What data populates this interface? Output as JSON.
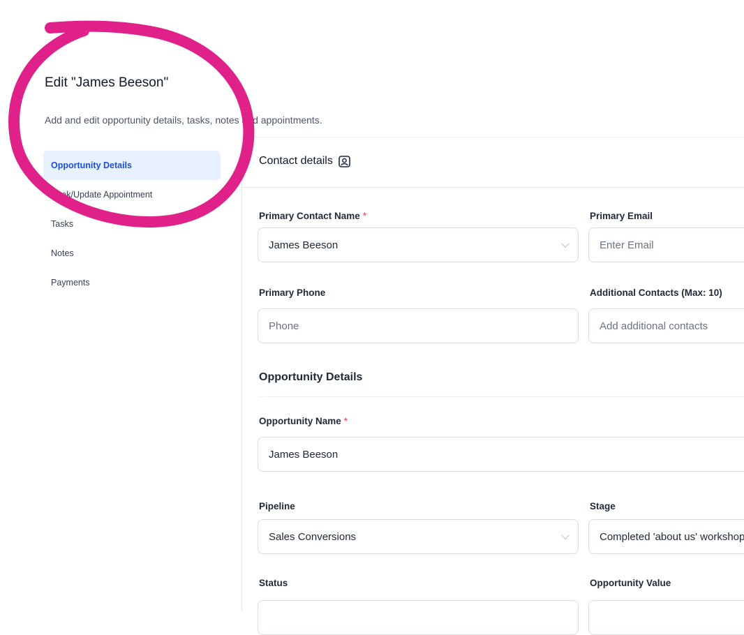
{
  "header": {
    "title": "Edit \"James Beeson\"",
    "subtitle": "Add and edit opportunity details, tasks, notes and appointments."
  },
  "sidebar": {
    "items": [
      {
        "label": "Opportunity Details",
        "active": true
      },
      {
        "label": "Book/Update Appointment",
        "active": false
      },
      {
        "label": "Tasks",
        "active": false
      },
      {
        "label": "Notes",
        "active": false
      },
      {
        "label": "Payments",
        "active": false
      }
    ]
  },
  "contact_section": {
    "title": "Contact details",
    "primary_contact_label": "Primary Contact Name",
    "primary_contact_value": "James Beeson",
    "primary_email_label": "Primary Email",
    "primary_email_placeholder": "Enter Email",
    "primary_phone_label": "Primary Phone",
    "primary_phone_placeholder": "Phone",
    "additional_contacts_label": "Additional Contacts (Max: 10)",
    "additional_contacts_placeholder": "Add additional contacts"
  },
  "opportunity_section": {
    "title": "Opportunity Details",
    "name_label": "Opportunity Name",
    "name_value": "James Beeson",
    "pipeline_label": "Pipeline",
    "pipeline_value": "Sales Conversions",
    "stage_label": "Stage",
    "stage_value": "Completed 'about us' workshop",
    "status_label": "Status",
    "value_label": "Opportunity Value"
  },
  "colors": {
    "annotation_circle": "#e0218a",
    "active_nav_bg": "#e8f1ff",
    "active_nav_text": "#1d4ed8",
    "required_star": "#ef4444"
  },
  "icons": {
    "contact_details": "contact-card-icon",
    "dropdown": "chevron-down-icon"
  }
}
